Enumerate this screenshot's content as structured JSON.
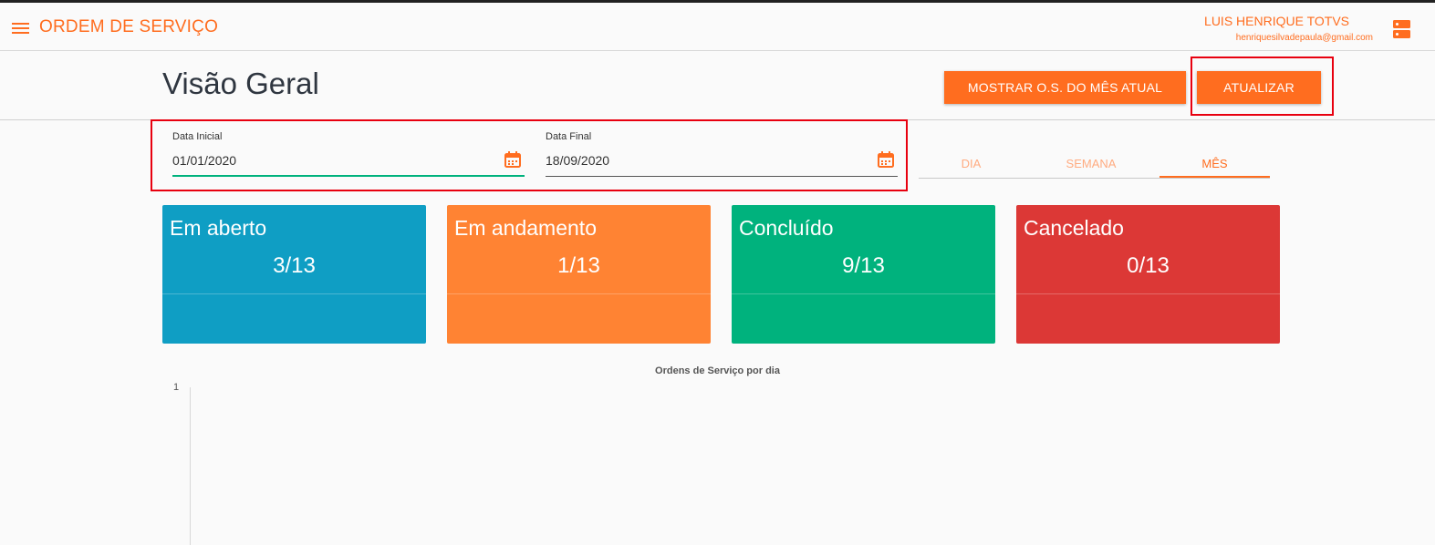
{
  "appbar": {
    "title": "ORDEM DE SERVIÇO",
    "user_name": "LUIS HENRIQUE TOTVS",
    "user_email": "henriquesilvadepaula@gmail.com",
    "menu_icon": "hamburger-menu-icon",
    "user_icon": "server-icon"
  },
  "header": {
    "title": "Visão Geral",
    "btn_month": "MOSTRAR O.S. DO MÊS ATUAL",
    "btn_refresh": "ATUALIZAR"
  },
  "filters": {
    "start_label": "Data Inicial",
    "start_value": "01/01/2020",
    "end_label": "Data Final",
    "end_value": "18/09/2020",
    "calendar_icon": "calendar-icon"
  },
  "tabs": [
    {
      "label": "DIA",
      "active": false
    },
    {
      "label": "SEMANA",
      "active": false
    },
    {
      "label": "MÊS",
      "active": true
    }
  ],
  "cards": [
    {
      "title": "Em aberto",
      "value": "3/13",
      "color": "#0f9ec4"
    },
    {
      "title": "Em andamento",
      "value": "1/13",
      "color": "#ff8333"
    },
    {
      "title": "Concluído",
      "value": "9/13",
      "color": "#00b27d"
    },
    {
      "title": "Cancelado",
      "value": "0/13",
      "color": "#dc3836"
    }
  ],
  "chart": {
    "title": "Ordens de Serviço por dia",
    "y_tick": "1"
  },
  "colors": {
    "accent": "#ff6d1f",
    "highlight": "#e8000f",
    "field_focus": "#00b27d"
  }
}
